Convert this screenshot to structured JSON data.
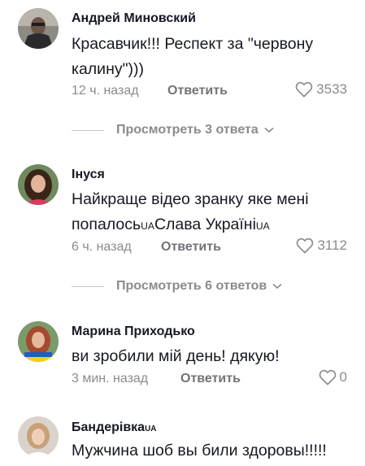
{
  "comments": [
    {
      "username": "Андрей Миновский",
      "text": "Красавчик!!! Респект за \"червону калину\")))",
      "time": "12 ч. назад",
      "reply_label": "Ответить",
      "likes": "3533",
      "view_replies": "Просмотреть 3 ответа"
    },
    {
      "username": "Інуся",
      "text_parts": [
        "Найкраще відео зранку яке мені попалось",
        "UA",
        "Слава Україні",
        "UA"
      ],
      "time": "6 ч. назад",
      "reply_label": "Ответить",
      "likes": "3112",
      "view_replies": "Просмотреть 6 ответов"
    },
    {
      "username": "Марина Приходько",
      "text": "ви зробили мій день! дякую!",
      "time": "3 мин. назад",
      "reply_label": "Ответить",
      "likes": "0"
    },
    {
      "username_parts": [
        "Бандерівка",
        "UA"
      ],
      "text": "Мужчина шоб вы били здоровы!!!!!"
    }
  ],
  "icons": {
    "like": "heart-outline-icon",
    "expand": "chevron-down-icon"
  },
  "colors": {
    "primary_text": "#161823",
    "secondary_text": "#8a8b91",
    "reply_text": "#72737a"
  }
}
